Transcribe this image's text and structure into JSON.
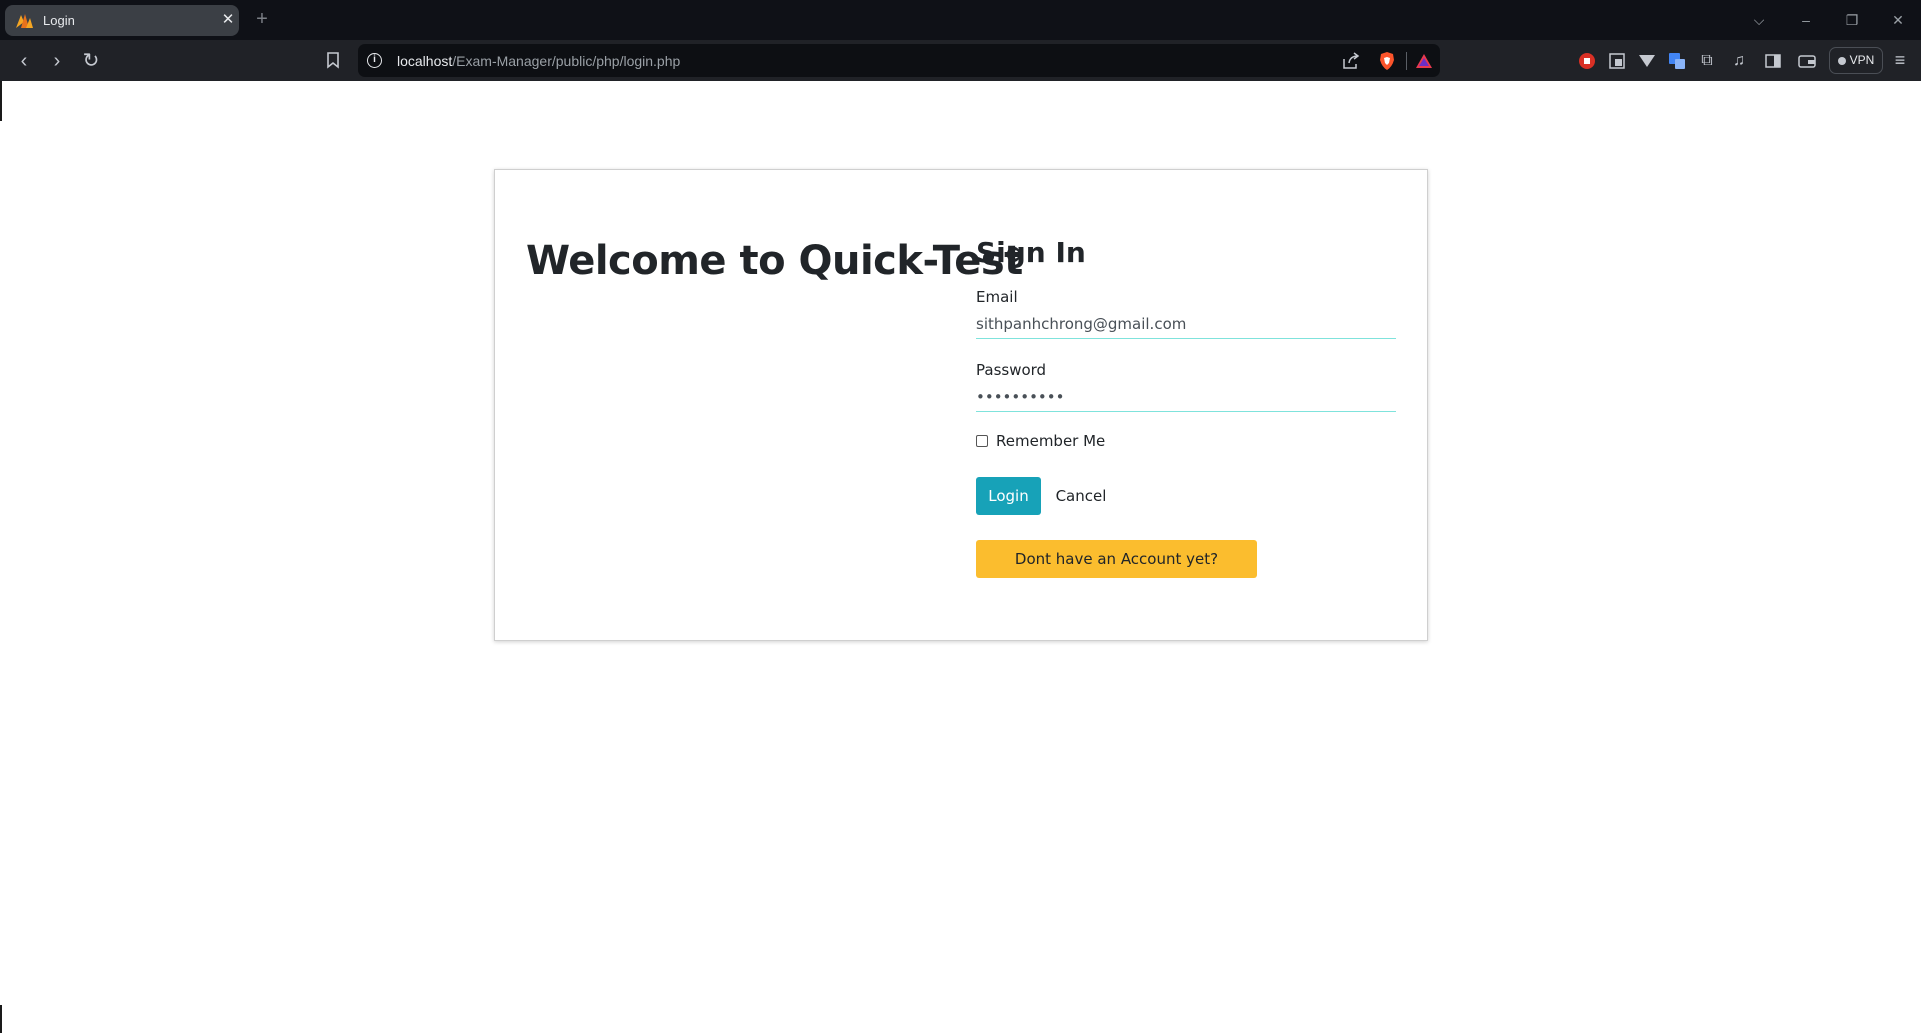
{
  "browser": {
    "tab": {
      "title": "Login",
      "close_glyph": "✕",
      "favicon": "tab-favicon-icon"
    },
    "new_tab_glyph": "+",
    "window_controls": {
      "dropdown": "⌵",
      "minimize": "–",
      "restore": "❐",
      "close": "✕"
    },
    "nav": {
      "back": "‹",
      "forward": "›",
      "reload": "↻",
      "bookmark": "⌑"
    },
    "address": {
      "info_glyph": "i",
      "host": "localhost",
      "path": "/Exam-Manager/public/php/login.php"
    },
    "extensions": [
      "stop-icon",
      "reader-icon",
      "vivaldi-icon",
      "translate-icon",
      "extensions-icon",
      "music-icon",
      "sidebar-icon",
      "wallet-icon"
    ],
    "vpn_label": "VPN",
    "menu_glyph": "≡"
  },
  "page": {
    "welcome_heading": "Welcome to Quick-Test",
    "form": {
      "title": "Sign In",
      "email_label": "Email",
      "email_value": "sithpanhchrong@gmail.com",
      "password_label": "Password",
      "password_value": "••••••••••",
      "remember_label": "Remember Me",
      "remember_checked": false,
      "login_button": "Login",
      "cancel_button": "Cancel",
      "register_button": "Dont have an Account yet?"
    }
  },
  "colors": {
    "login_button": "#17a2b8",
    "register_button": "#fbbd2e",
    "input_underline": "#7fe3dc",
    "chrome_dark": "#0f1117"
  }
}
